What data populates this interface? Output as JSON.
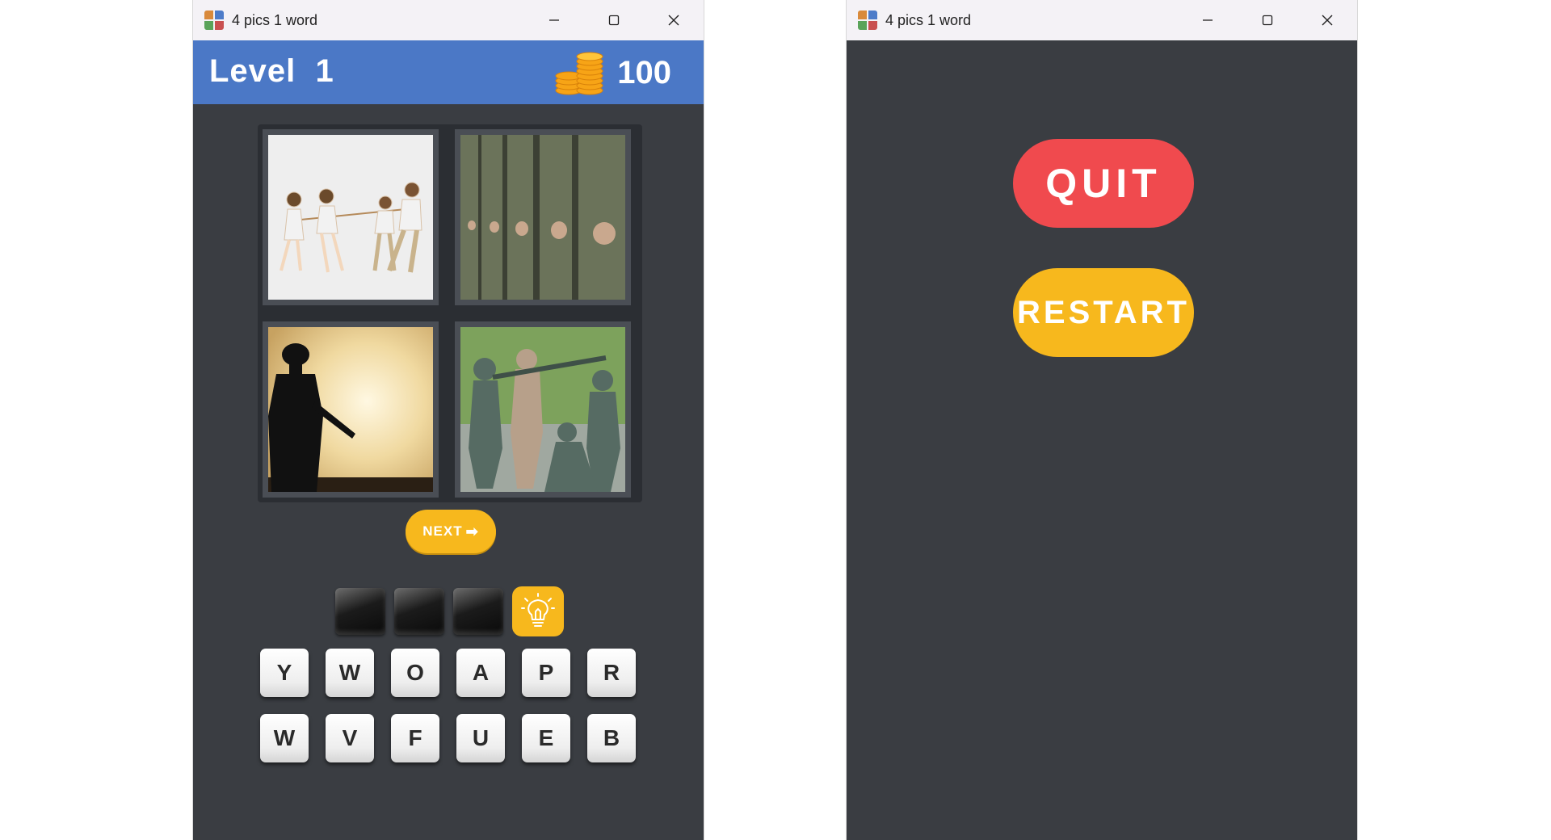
{
  "windows": [
    {
      "title": "4 pics 1 word",
      "controls": {
        "minimize": "minimize-icon",
        "maximize": "maximize-icon",
        "close": "close-icon"
      }
    },
    {
      "title": "4 pics 1 word",
      "controls": {
        "minimize": "minimize-icon",
        "maximize": "maximize-icon",
        "close": "close-icon"
      }
    }
  ],
  "game": {
    "level_label": "Level  1",
    "coins": "100",
    "coins_icon": "coin-stack-icon",
    "pictures": [
      "children-tug-of-war",
      "soldiers-in-line",
      "soldier-silhouette-sunset",
      "toy-army-men"
    ],
    "next_label": "NEXT",
    "next_icon": "arrow-right-icon",
    "answer_slots": 3,
    "hint_icon": "lightbulb-icon",
    "keys_row_1": [
      "Y",
      "W",
      "O",
      "A",
      "P",
      "R"
    ],
    "keys_row_2": [
      "W",
      "V",
      "F",
      "U",
      "E",
      "B"
    ]
  },
  "menu": {
    "quit_label": "QUIT",
    "restart_label": "RESTART"
  },
  "colors": {
    "header_blue": "#4b78c6",
    "background": "#3a3d42",
    "accent_yellow": "#f7b81d",
    "quit_red": "#f04a4e"
  }
}
